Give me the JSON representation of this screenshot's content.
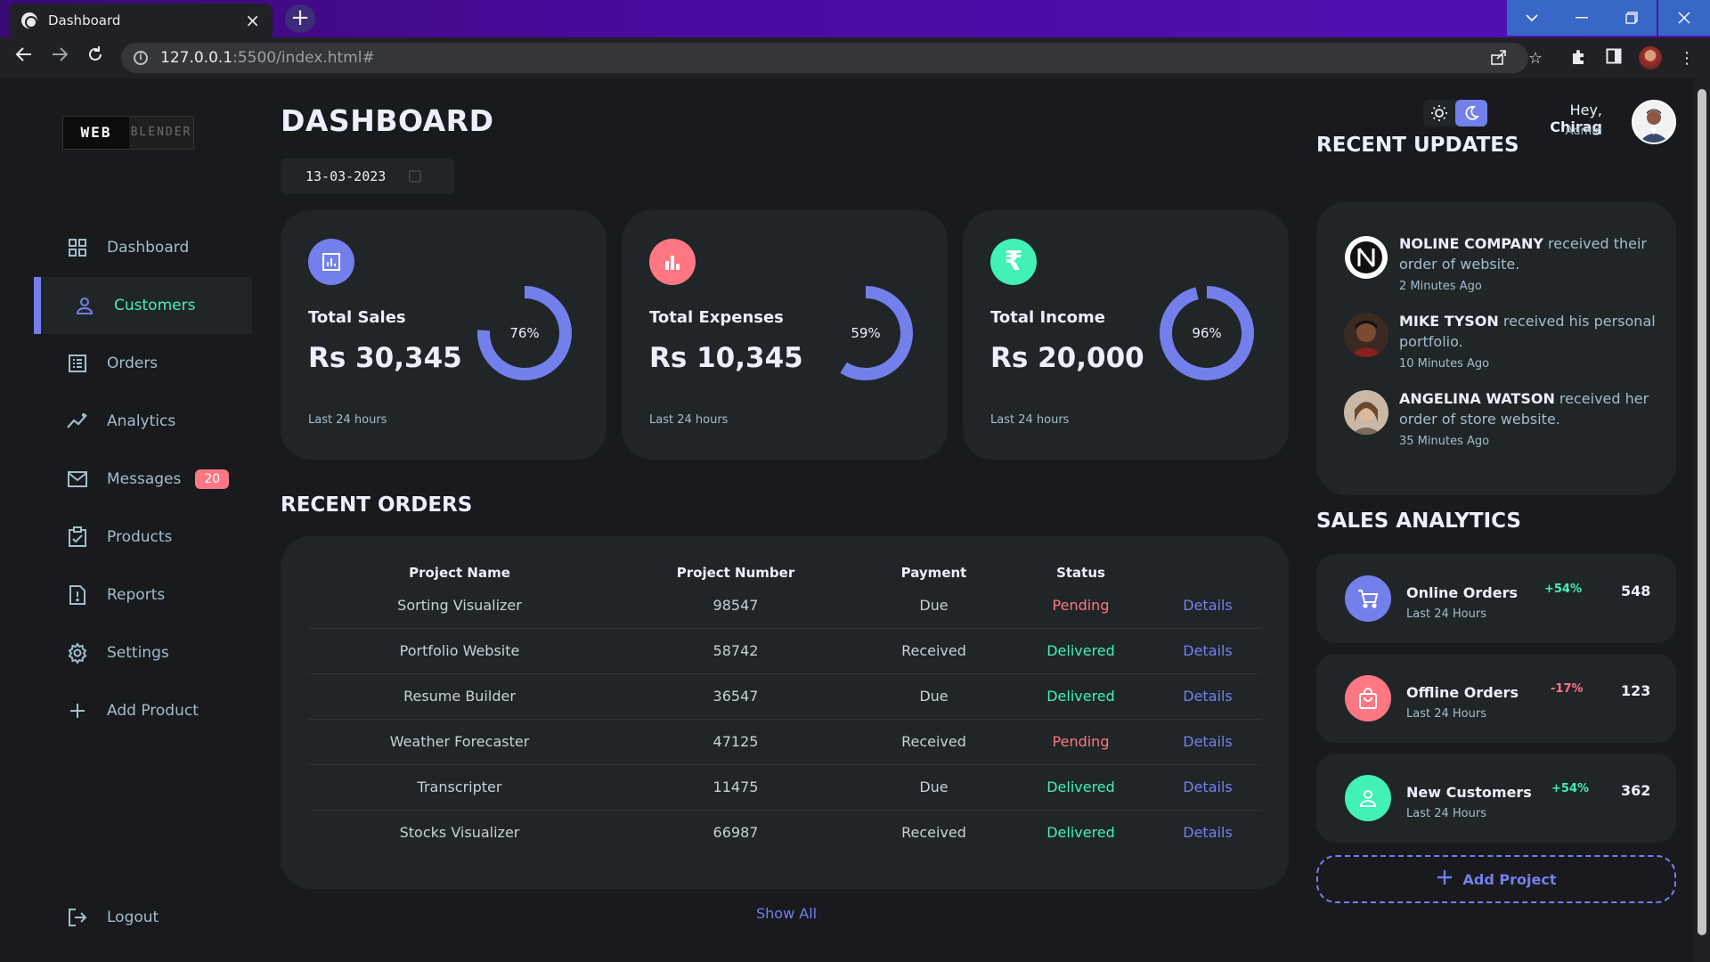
{
  "browser": {
    "tab_title": "Dashboard",
    "url_host": "127.0.0.1",
    "url_rest": ":5500/index.html#"
  },
  "sidebar": {
    "logo_left": "WEB",
    "logo_right": "BLENDER",
    "items": [
      {
        "label": "Dashboard",
        "icon": "grid-icon"
      },
      {
        "label": "Customers",
        "icon": "person-icon",
        "active": true
      },
      {
        "label": "Orders",
        "icon": "receipt-icon"
      },
      {
        "label": "Analytics",
        "icon": "insights-icon"
      },
      {
        "label": "Messages",
        "icon": "mail-icon",
        "badge": "20"
      },
      {
        "label": "Products",
        "icon": "inventory-icon"
      },
      {
        "label": "Reports",
        "icon": "report-icon"
      },
      {
        "label": "Settings",
        "icon": "gear-icon"
      },
      {
        "label": "Add Product",
        "icon": "plus-icon"
      },
      {
        "label": "Logout",
        "icon": "logout-icon"
      }
    ]
  },
  "main": {
    "title": "DASHBOARD",
    "date": "13-03-2023",
    "cards": [
      {
        "label": "Total Sales",
        "value": "Rs 30,345",
        "percent": "76%",
        "fraction": 0.76,
        "footer": "Last 24 hours",
        "icon": "analytics-icon",
        "color": "#7380ec"
      },
      {
        "label": "Total Expenses",
        "value": "Rs 10,345",
        "percent": "59%",
        "fraction": 0.59,
        "footer": "Last 24 hours",
        "icon": "bar-chart-icon",
        "color": "#ff7782"
      },
      {
        "label": "Total Income",
        "value": "Rs 20,000",
        "percent": "96%",
        "fraction": 0.96,
        "footer": "Last 24 hours",
        "icon": "rupee-icon",
        "color": "#41f1b6"
      }
    ],
    "recent_orders_title": "RECENT ORDERS",
    "orders_headers": [
      "Project Name",
      "Project Number",
      "Payment",
      "Status",
      ""
    ],
    "orders": [
      {
        "name": "Sorting Visualizer",
        "number": "98547",
        "payment": "Due",
        "status": "Pending",
        "action": "Details"
      },
      {
        "name": "Portfolio Website",
        "number": "58742",
        "payment": "Received",
        "status": "Delivered",
        "action": "Details"
      },
      {
        "name": "Resume Builder",
        "number": "36547",
        "payment": "Due",
        "status": "Delivered",
        "action": "Details"
      },
      {
        "name": "Weather Forecaster",
        "number": "47125",
        "payment": "Received",
        "status": "Pending",
        "action": "Details"
      },
      {
        "name": "Transcripter",
        "number": "11475",
        "payment": "Due",
        "status": "Delivered",
        "action": "Details"
      },
      {
        "name": "Stocks Visualizer",
        "number": "66987",
        "payment": "Received",
        "status": "Delivered",
        "action": "Details"
      }
    ],
    "show_all": "Show All"
  },
  "right": {
    "greeting": "Hey,",
    "user_name": "Chirag",
    "role": "Admin",
    "updates_title": "RECENT UPDATES",
    "updates": [
      {
        "name": "NOLINE COMPANY",
        "text": " received their order of website.",
        "time": "2 Minutes Ago"
      },
      {
        "name": "MIKE TYSON",
        "text": " received his personal portfolio.",
        "time": "10 Minutes Ago"
      },
      {
        "name": "ANGELINA WATSON",
        "text": " received her order of store website.",
        "time": "35 Minutes Ago"
      }
    ],
    "analytics_title": "SALES ANALYTICS",
    "analytics": [
      {
        "name": "Online Orders",
        "sub": "Last 24 Hours",
        "pct": "+54%",
        "count": "548",
        "icon": "cart-icon",
        "color": "#7380ec",
        "pct_color": "#41f1b6"
      },
      {
        "name": "Offline Orders",
        "sub": "Last 24 Hours",
        "pct": "-17%",
        "count": "123",
        "icon": "bag-icon",
        "color": "#ff7782",
        "pct_color": "#ff7782"
      },
      {
        "name": "New Customers",
        "sub": "Last 24 Hours",
        "pct": "+54%",
        "count": "362",
        "icon": "person-icon",
        "color": "#41f1b6",
        "pct_color": "#41f1b6"
      }
    ],
    "add_project": "Add Project"
  },
  "colors": {
    "primary": "#7380ec",
    "danger": "#ff7782",
    "success": "#41f1b6",
    "background": "#181a1e",
    "card": "#202528"
  }
}
